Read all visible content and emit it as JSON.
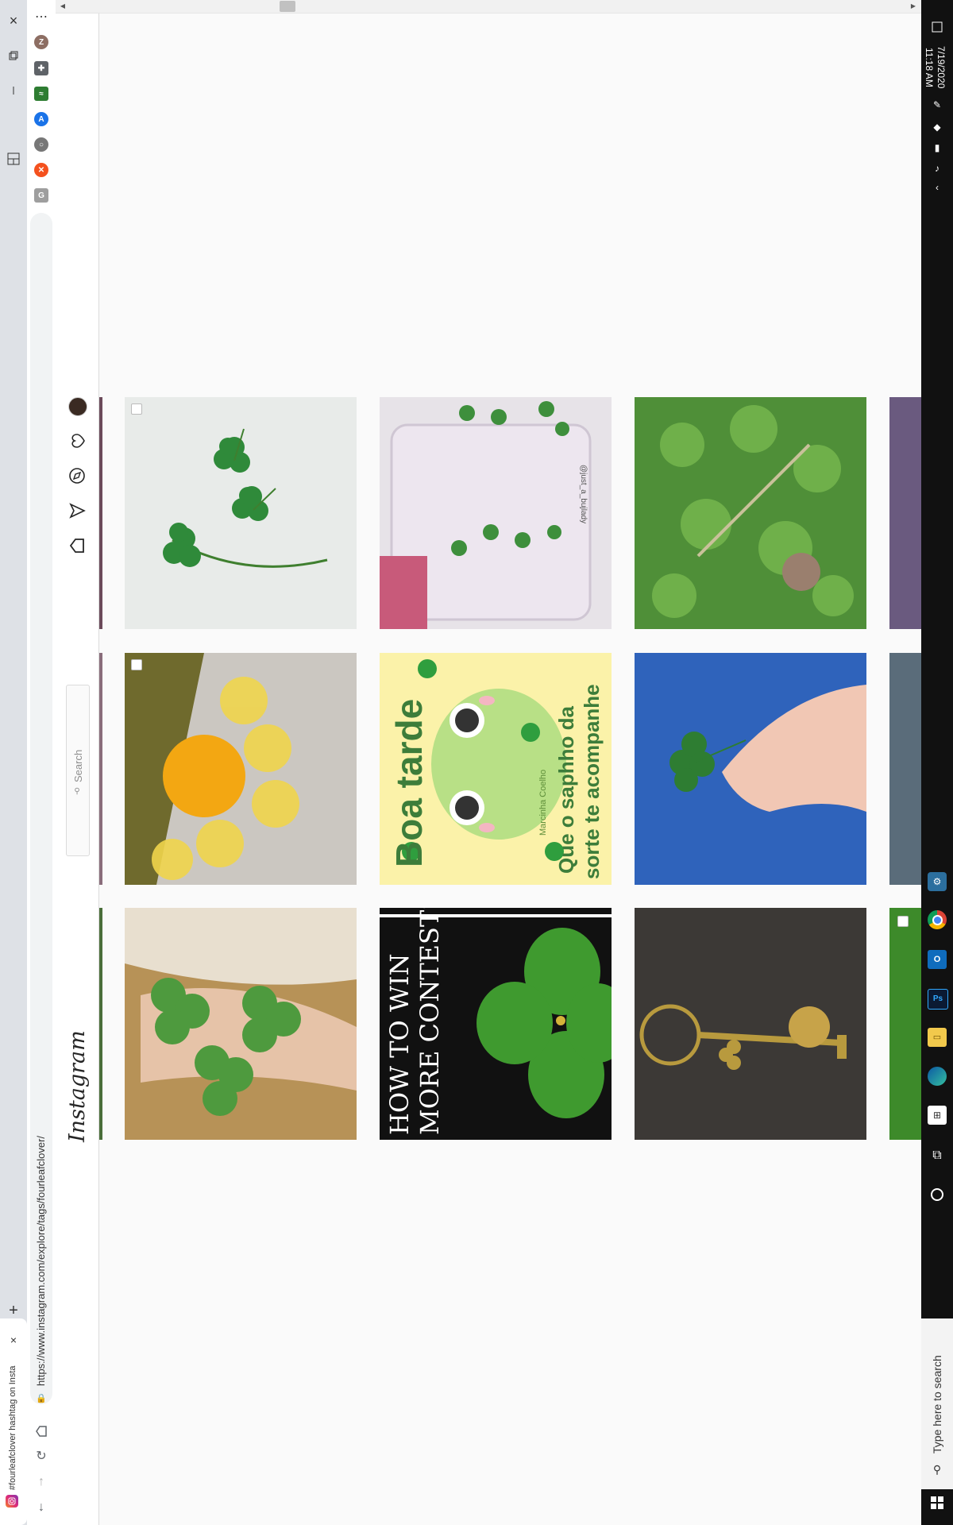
{
  "browser": {
    "tab_title": "#fourleafclover hashtag on Insta",
    "url": "https://www.instagram.com/explore/tags/fourleafclover/",
    "new_tab_glyph": "+",
    "close_glyph": "×",
    "menu_glyph": "⋯",
    "profile_initial": "Z",
    "extensions": [
      {
        "name": "puzzle-icon",
        "color": "#5f6368"
      },
      {
        "name": "chart-icon",
        "color": "#2e7d32"
      },
      {
        "name": "translate-icon",
        "color": "#1a73e8"
      },
      {
        "name": "circle-icon",
        "color": "#777777"
      },
      {
        "name": "x-icon",
        "color": "#f4511e"
      },
      {
        "name": "g-icon",
        "color": "#9e9e9e"
      }
    ]
  },
  "instagram": {
    "logo": "Instagram",
    "search_placeholder": "Search",
    "nav": [
      "home-icon",
      "direct-icon",
      "explore-icon",
      "activity-icon",
      "profile-avatar"
    ]
  },
  "grid": {
    "caption_frog_1": "Boa tarde",
    "caption_frog_2": "Que o saphho da",
    "caption_frog_3": "sorte te acompanhe",
    "caption_frog_small": "Marcinha Coelho",
    "caption_contest_1": "HOW TO WIN",
    "caption_contest_2": "MORE CONTESTS",
    "watermark": "@just_a_bujlady"
  },
  "taskbar": {
    "time": "11:18 AM",
    "date": "7/19/2020",
    "search_placeholder": "Type here to search"
  }
}
